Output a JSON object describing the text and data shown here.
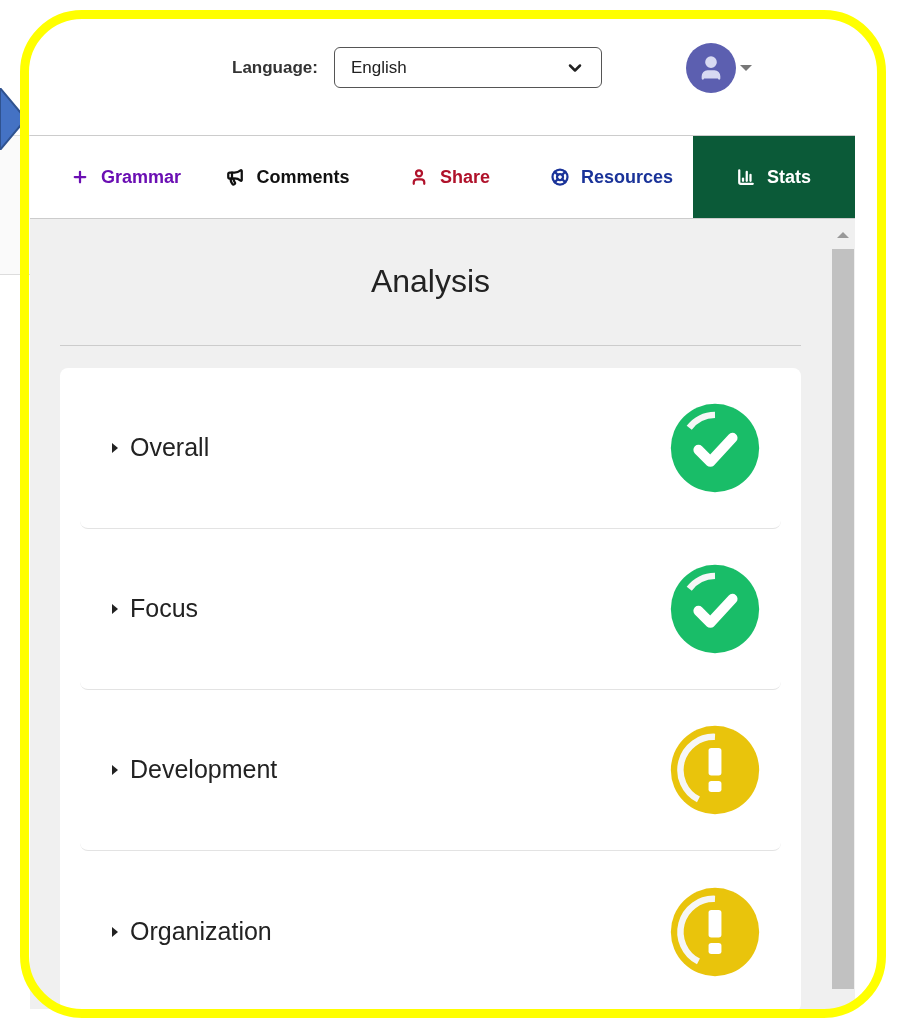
{
  "header": {
    "language_label": "Language:",
    "language_value": "English"
  },
  "tabs": [
    {
      "label": "Grammar",
      "color": "#6b0fb3",
      "selected": false
    },
    {
      "label": "Comments",
      "color": "#111111",
      "selected": false
    },
    {
      "label": "Share",
      "color": "#b0122b",
      "selected": false
    },
    {
      "label": "Resources",
      "color": "#1a3399",
      "selected": false
    },
    {
      "label": "Stats",
      "color": "#ffffff",
      "selected": true
    }
  ],
  "panel": {
    "title": "Analysis",
    "items": [
      {
        "label": "Overall",
        "kind": "pass",
        "expanded": false
      },
      {
        "label": "Focus",
        "kind": "pass",
        "expanded": false
      },
      {
        "label": "Development",
        "kind": "warn",
        "expanded": false
      },
      {
        "label": "Organization",
        "kind": "warn",
        "expanded": false
      }
    ]
  }
}
